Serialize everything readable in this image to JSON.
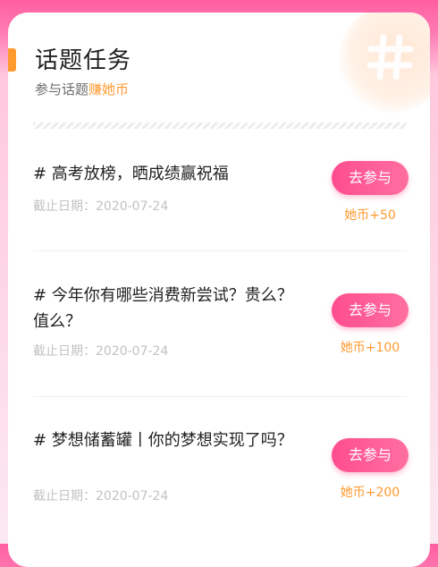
{
  "header": {
    "title": "话题任务",
    "subtitle_prefix": "参与话题",
    "subtitle_highlight": "赚她币"
  },
  "tasks": [
    {
      "title": "# 高考放榜，晒成绩赢祝福",
      "deadline": "截止日期：2020-07-24",
      "button_label": "去参与",
      "reward": "她币+50"
    },
    {
      "title": "# 今年你有哪些消费新尝试？贵么？值么？",
      "deadline": "截止日期：2020-07-24",
      "button_label": "去参与",
      "reward": "她币+100"
    },
    {
      "title": "# 梦想储蓄罐丨你的梦想实现了吗？",
      "deadline": "截止日期：2020-07-24",
      "button_label": "去参与",
      "reward": "她币+200"
    }
  ],
  "colors": {
    "accent_orange": "#ff9a2f",
    "button_pink": "#ff4d8f",
    "background_pink": "#ff5fa2"
  }
}
